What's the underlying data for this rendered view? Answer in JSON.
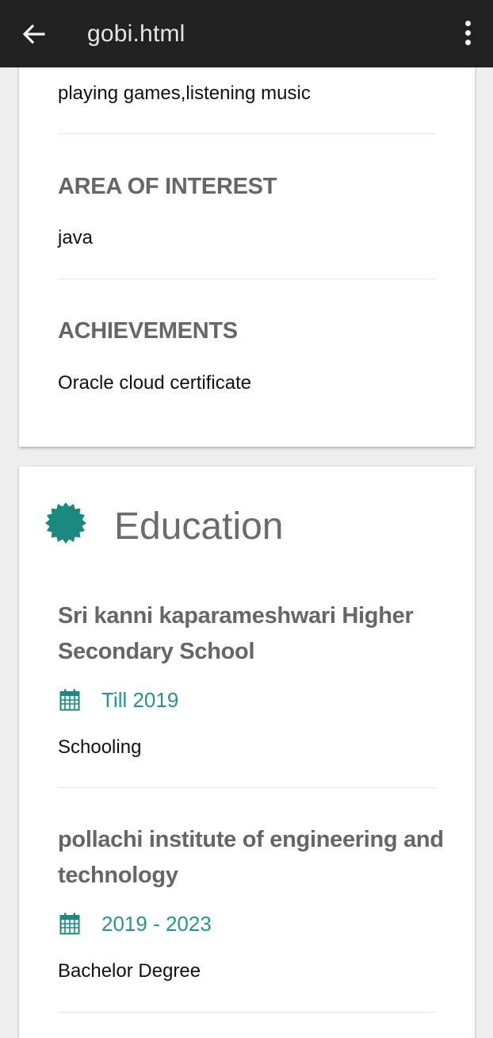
{
  "appbar": {
    "title": "gobi.html"
  },
  "hobbies": {
    "text": "playing games,listening music"
  },
  "area_of_interest": {
    "heading": "AREA OF INTEREST",
    "text": "java"
  },
  "achievements": {
    "heading": "ACHIEVEMENTS",
    "text": "Oracle cloud certificate"
  },
  "education": {
    "title": "Education",
    "icon": "badge-icon",
    "accent_color": "#1a8a80",
    "entries": [
      {
        "school": "Sri kanni kaparameshwari Higher Secondary School",
        "date": "Till 2019",
        "detail": "Schooling"
      },
      {
        "school": "pollachi institute of engineering and technology",
        "date": "2019 - 2023",
        "detail": "Bachelor Degree"
      }
    ]
  }
}
